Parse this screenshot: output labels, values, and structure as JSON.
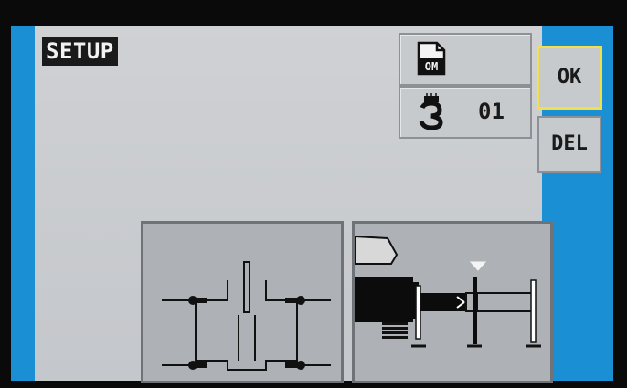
{
  "screen": {
    "title": "SETUP"
  },
  "buttons": {
    "doc_icon_label": "OM",
    "hook_value": "01",
    "ok_label": "OK",
    "del_label": "DEL"
  },
  "icons": {
    "doc": "document-om-icon",
    "hook": "crane-hook-icon"
  },
  "colors": {
    "frame": "#1b8fd3",
    "panel": "#c8cbce",
    "ok_highlight": "#f2e04a",
    "title_bg": "#1a1a1a"
  }
}
